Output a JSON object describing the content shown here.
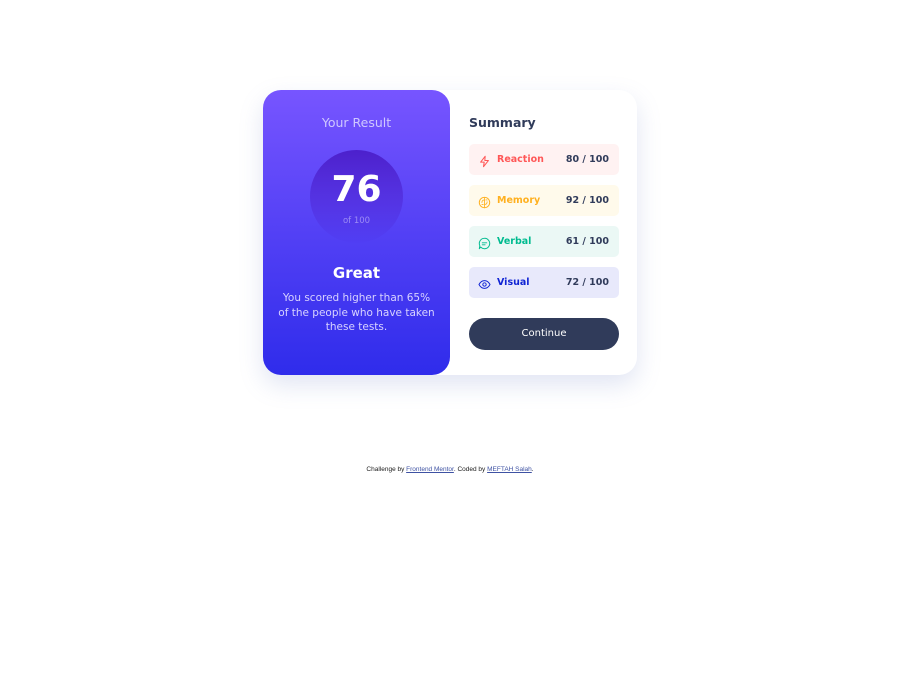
{
  "result": {
    "title": "Your Result",
    "score": "76",
    "score_total": "of 100",
    "verdict": "Great",
    "description": "You scored higher than 65% of the people who have taken these tests."
  },
  "summary": {
    "title": "Summary",
    "items": [
      {
        "label": "Reaction",
        "score": "80",
        "total": " / 100",
        "icon": "lightning-icon",
        "color": "#ff5757",
        "bg": "#fff2f2"
      },
      {
        "label": "Memory",
        "score": "92",
        "total": " / 100",
        "icon": "brain-icon",
        "color": "#ffb01f",
        "bg": "#fffaeb"
      },
      {
        "label": "Verbal",
        "score": "61",
        "total": " / 100",
        "icon": "chat-bubble-icon",
        "color": "#00bb8f",
        "bg": "#ebf8f5"
      },
      {
        "label": "Visual",
        "score": "72",
        "total": " / 100",
        "icon": "eye-icon",
        "color": "#1125d4",
        "bg": "#e8e9fb"
      }
    ],
    "continue_label": "Continue"
  },
  "attribution": {
    "prefix": "Challenge by ",
    "link1": "Frontend Mentor",
    "middle": ". Coded by ",
    "link2": "MEFTAH Salah",
    "suffix": "."
  }
}
